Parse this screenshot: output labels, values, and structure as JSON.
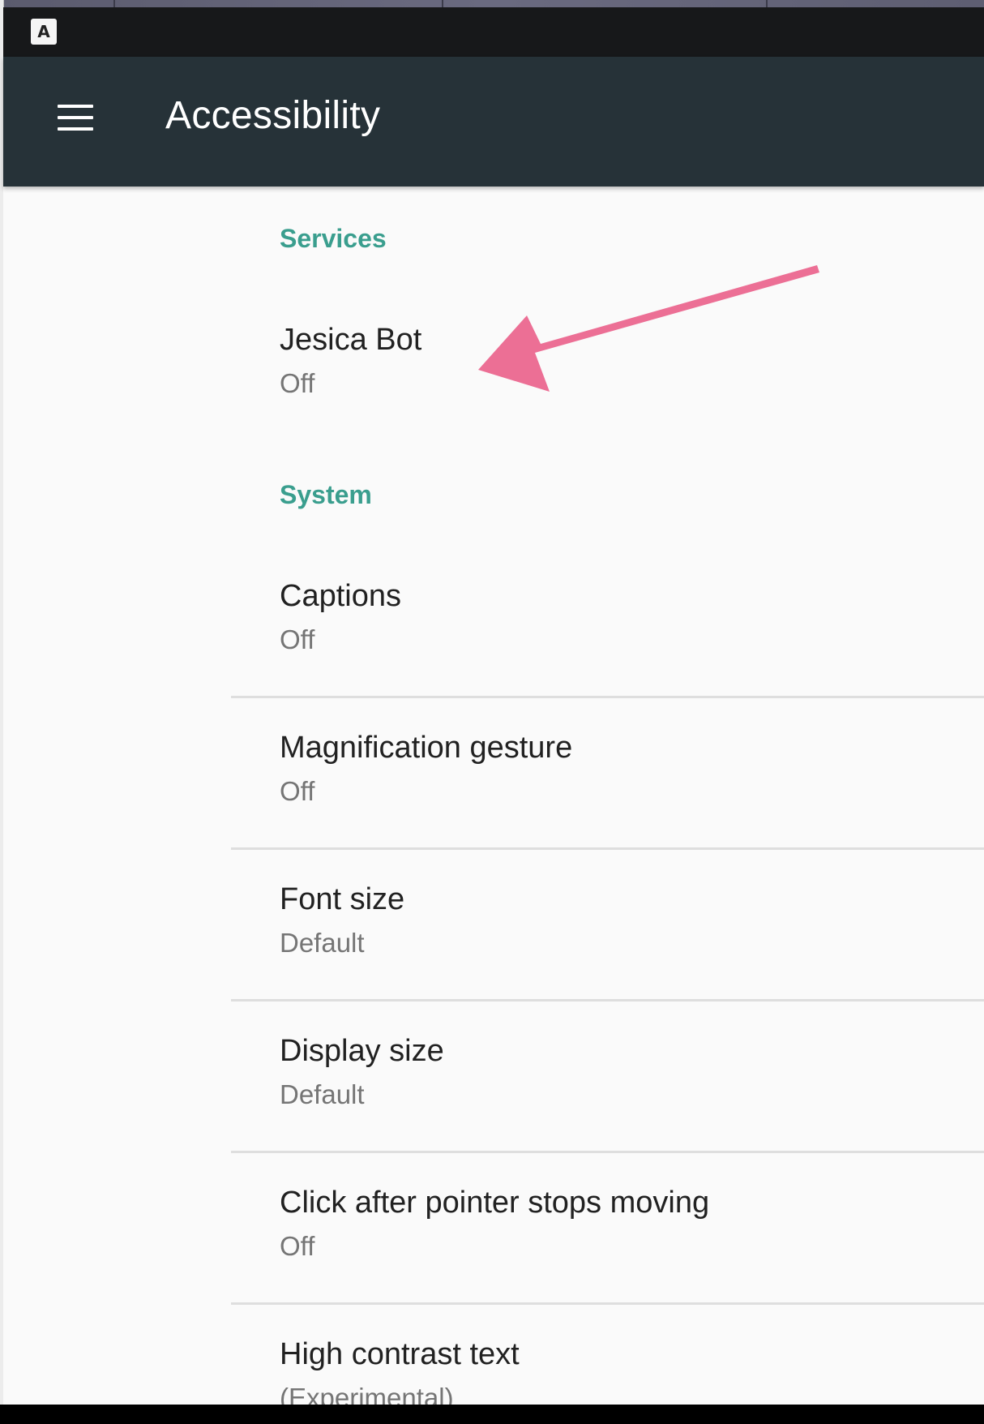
{
  "toolbar": {
    "title": "Accessibility"
  },
  "status_bar": {
    "app_icon_letter": "A"
  },
  "sections": {
    "services": {
      "header": "Services",
      "items": [
        {
          "title": "Jesica Bot",
          "summary": "Off"
        }
      ]
    },
    "system": {
      "header": "System",
      "items": [
        {
          "title": "Captions",
          "summary": "Off"
        },
        {
          "title": "Magnification gesture",
          "summary": "Off"
        },
        {
          "title": "Font size",
          "summary": "Default"
        },
        {
          "title": "Display size",
          "summary": "Default"
        },
        {
          "title": "Click after pointer stops moving",
          "summary": "Off"
        },
        {
          "title": "High contrast text",
          "summary": "(Experimental)"
        }
      ]
    }
  },
  "colors": {
    "toolbar": "#263238",
    "status_bar": "#17181a",
    "section_header": "#3a9e8e",
    "annotation_arrow": "#ec6f95"
  },
  "icons": {
    "menu": "hamburger-menu-icon",
    "annotation": "pointer-arrow-icon"
  }
}
